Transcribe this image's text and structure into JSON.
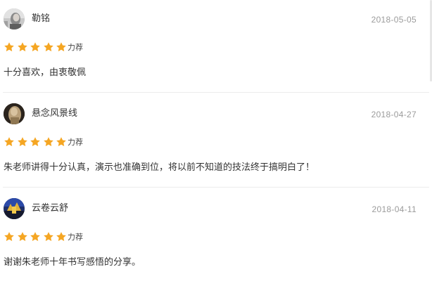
{
  "reviews": [
    {
      "username": "勒铭",
      "date": "2018-05-05",
      "rating": 5,
      "rating_label": "力荐",
      "content": "十分喜欢，由衷敬佩"
    },
    {
      "username": "悬念风景线",
      "date": "2018-04-27",
      "rating": 5,
      "rating_label": "力荐",
      "content": "朱老师讲得十分认真，演示也准确到位，将以前不知道的技法终于搞明白了！"
    },
    {
      "username": "云卷云舒",
      "date": "2018-04-11",
      "rating": 5,
      "rating_label": "力荐",
      "content": "谢谢朱老师十年书写感悟的分享。"
    }
  ],
  "colors": {
    "star": "#f5a623",
    "text": "#333333",
    "date": "#9b9b9b",
    "divider": "#ececec"
  },
  "icons": {
    "star": "star-icon"
  }
}
